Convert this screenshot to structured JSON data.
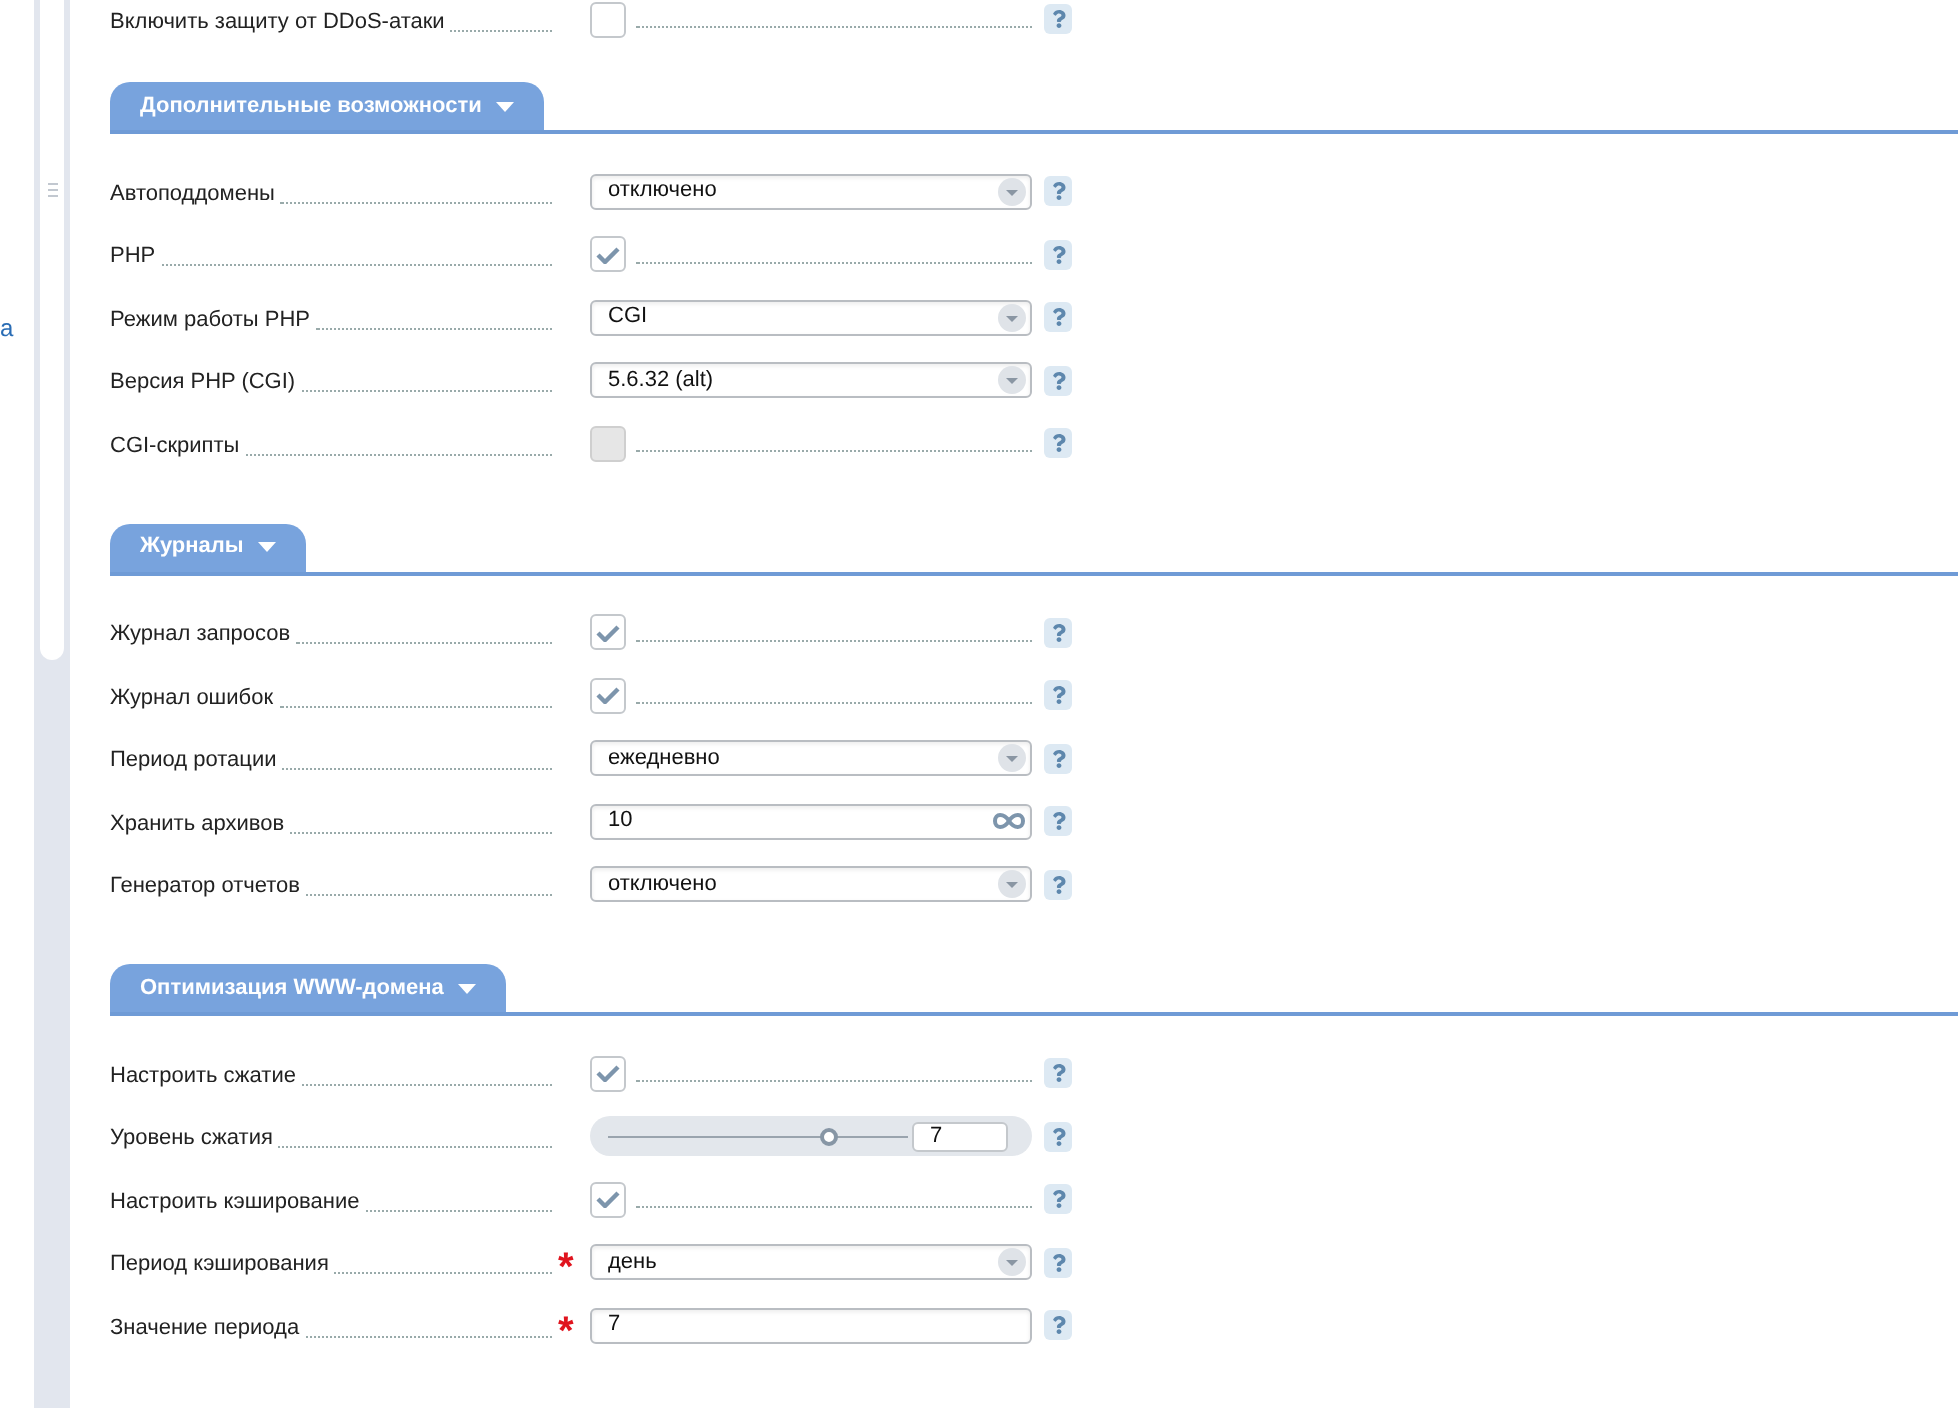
{
  "sidebar_link": "a",
  "top_row": {
    "label": "Включить защиту от DDoS-атаки",
    "kind": "checkbox",
    "checked": false,
    "disabled": false
  },
  "sections": [
    {
      "title": "Дополнительные возможности",
      "expanded": true,
      "rows": [
        {
          "label": "Автоподдомены",
          "kind": "select",
          "value": "отключено"
        },
        {
          "label": "PHP",
          "kind": "checkbox",
          "checked": true,
          "disabled": false
        },
        {
          "label": "Режим работы PHP",
          "kind": "select",
          "value": "CGI"
        },
        {
          "label": "Версия PHP (CGI)",
          "kind": "select",
          "value": "5.6.32 (alt)"
        },
        {
          "label": "CGI-скрипты",
          "kind": "checkbox",
          "checked": false,
          "disabled": true
        }
      ]
    },
    {
      "title": "Журналы",
      "expanded": true,
      "rows": [
        {
          "label": "Журнал запросов",
          "kind": "checkbox",
          "checked": true,
          "disabled": false
        },
        {
          "label": "Журнал ошибок",
          "kind": "checkbox",
          "checked": true,
          "disabled": false
        },
        {
          "label": "Период ротации",
          "kind": "select",
          "value": "ежедневно"
        },
        {
          "label": "Хранить архивов",
          "kind": "text",
          "value": "10",
          "unlimited_toggle": true
        },
        {
          "label": "Генератор отчетов",
          "kind": "select",
          "value": "отключено"
        }
      ]
    },
    {
      "title": "Оптимизация WWW-домена",
      "expanded": true,
      "rows": [
        {
          "label": "Настроить сжатие",
          "kind": "checkbox",
          "checked": true,
          "disabled": false
        },
        {
          "label": "Уровень сжатия",
          "kind": "slider",
          "level": 0.73,
          "value": "7"
        },
        {
          "label": "Настроить кэширование",
          "kind": "checkbox",
          "checked": true,
          "disabled": false
        },
        {
          "label": "Период кэширования",
          "kind": "select",
          "value": "день",
          "required_mark": "*"
        },
        {
          "label": "Значение периода",
          "kind": "text",
          "value": "7",
          "unlimited_toggle": false,
          "required_mark": "*"
        }
      ]
    }
  ]
}
